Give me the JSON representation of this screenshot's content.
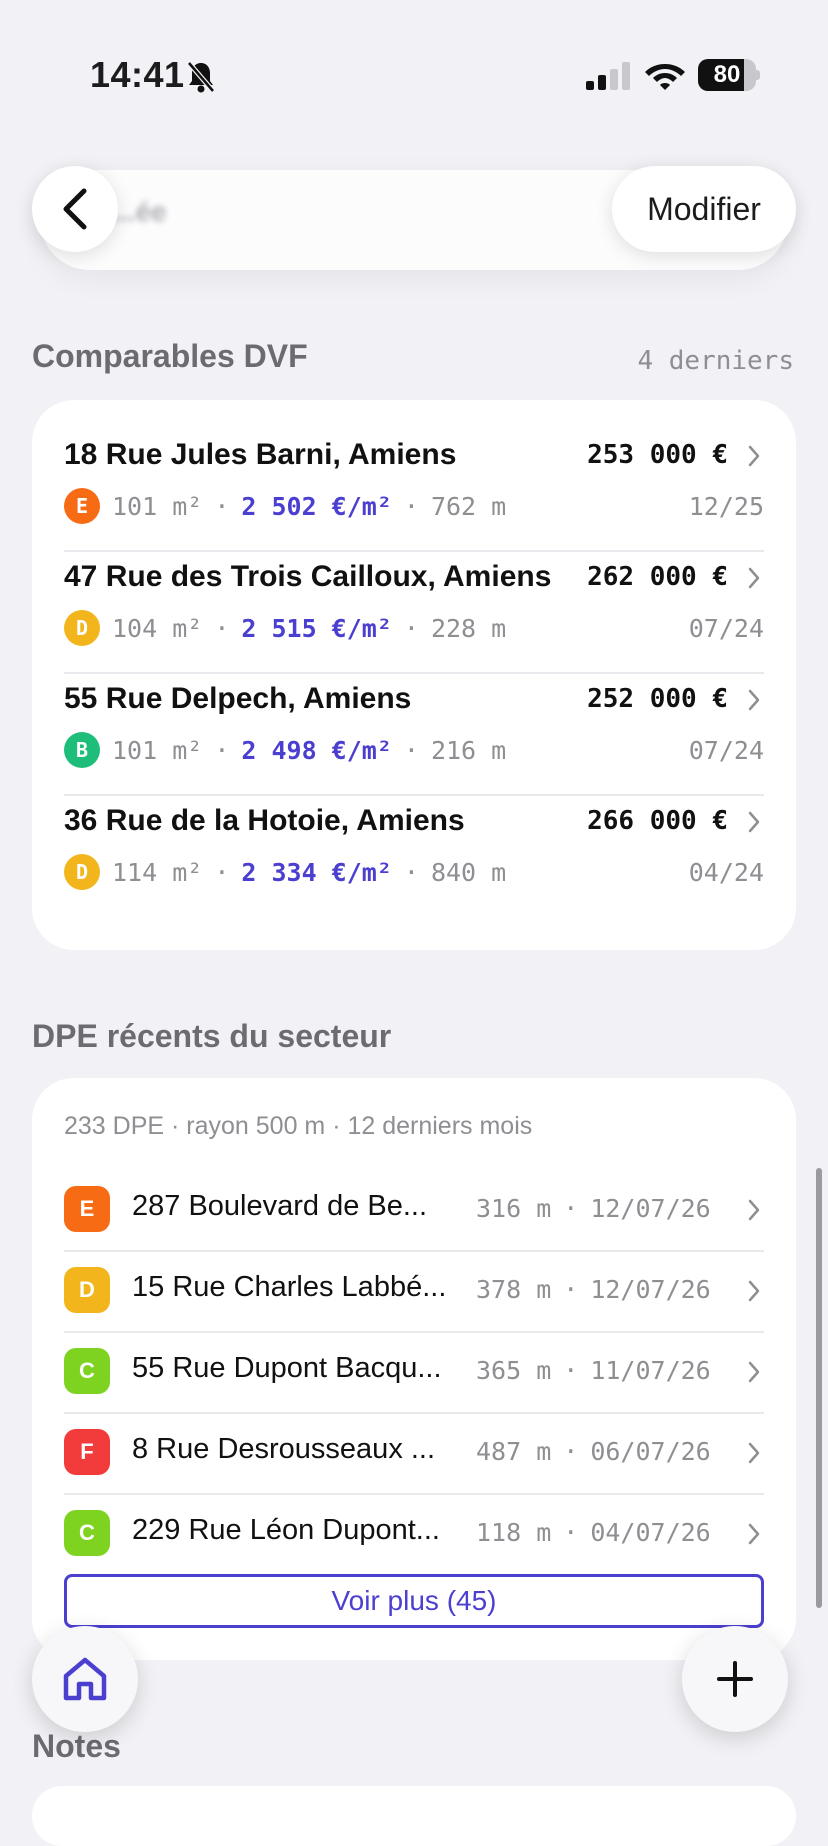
{
  "status_bar": {
    "time": "14:41",
    "battery": "80",
    "battery_level": 0.8,
    "icons": [
      "bell-slash-icon",
      "cellular-signal-icon",
      "wifi-icon",
      "battery-icon"
    ]
  },
  "nav": {
    "title": "...ée",
    "edit_label": "Modifier",
    "icons": [
      "chevron-left-icon"
    ]
  },
  "comparables": {
    "title": "Comparables DVF",
    "meta": "4 derniers",
    "items": [
      {
        "address": "18 Rue Jules Barni, Amiens",
        "price": "253 000 €",
        "dpe": "E",
        "surface": "101 m²",
        "price_per_m2": "2 502 €/m²",
        "distance": "762 m",
        "date": "12/25"
      },
      {
        "address": "47 Rue des Trois Cailloux, Amiens",
        "price": "262 000 €",
        "dpe": "D",
        "surface": "104 m²",
        "price_per_m2": "2 515 €/m²",
        "distance": "228 m",
        "date": "07/24"
      },
      {
        "address": "55 Rue Delpech, Amiens",
        "price": "252 000 €",
        "dpe": "B",
        "surface": "101 m²",
        "price_per_m2": "2 498 €/m²",
        "distance": "216 m",
        "date": "07/24"
      },
      {
        "address": "36 Rue de la Hotoie, Amiens",
        "price": "266 000 €",
        "dpe": "D",
        "surface": "114 m²",
        "price_per_m2": "2 334 €/m²",
        "distance": "840 m",
        "date": "04/24"
      }
    ]
  },
  "dpe_section": {
    "title": "DPE récents du secteur",
    "summary": "233 DPE · rayon 500 m · 12 derniers mois",
    "items": [
      {
        "dpe": "E",
        "address": "287 Boulevard de Be...",
        "distance": "316 m",
        "date": "12/07/26"
      },
      {
        "dpe": "D",
        "address": "15 Rue Charles Labbé...",
        "distance": "378 m",
        "date": "12/07/26"
      },
      {
        "dpe": "C",
        "address": "55 Rue Dupont Bacqu...",
        "distance": "365 m",
        "date": "11/07/26"
      },
      {
        "dpe": "F",
        "address": "8 Rue Desrousseaux ...",
        "distance": "487 m",
        "date": "06/07/26"
      },
      {
        "dpe": "C",
        "address": "229 Rue Léon Dupont...",
        "distance": "118 m",
        "date": "04/07/26"
      }
    ],
    "more_label": "Voir plus (45)"
  },
  "notes": {
    "title": "Notes"
  },
  "fabs": {
    "icons": [
      "home-icon",
      "plus-icon"
    ]
  },
  "colors": {
    "accent": "#4b3fd0",
    "dpe_B": "#1ebe7a",
    "dpe_C": "#7ed321",
    "dpe_D": "#f2b51c",
    "dpe_E": "#f76b15",
    "dpe_F": "#f23b3b"
  },
  "separator": "·"
}
